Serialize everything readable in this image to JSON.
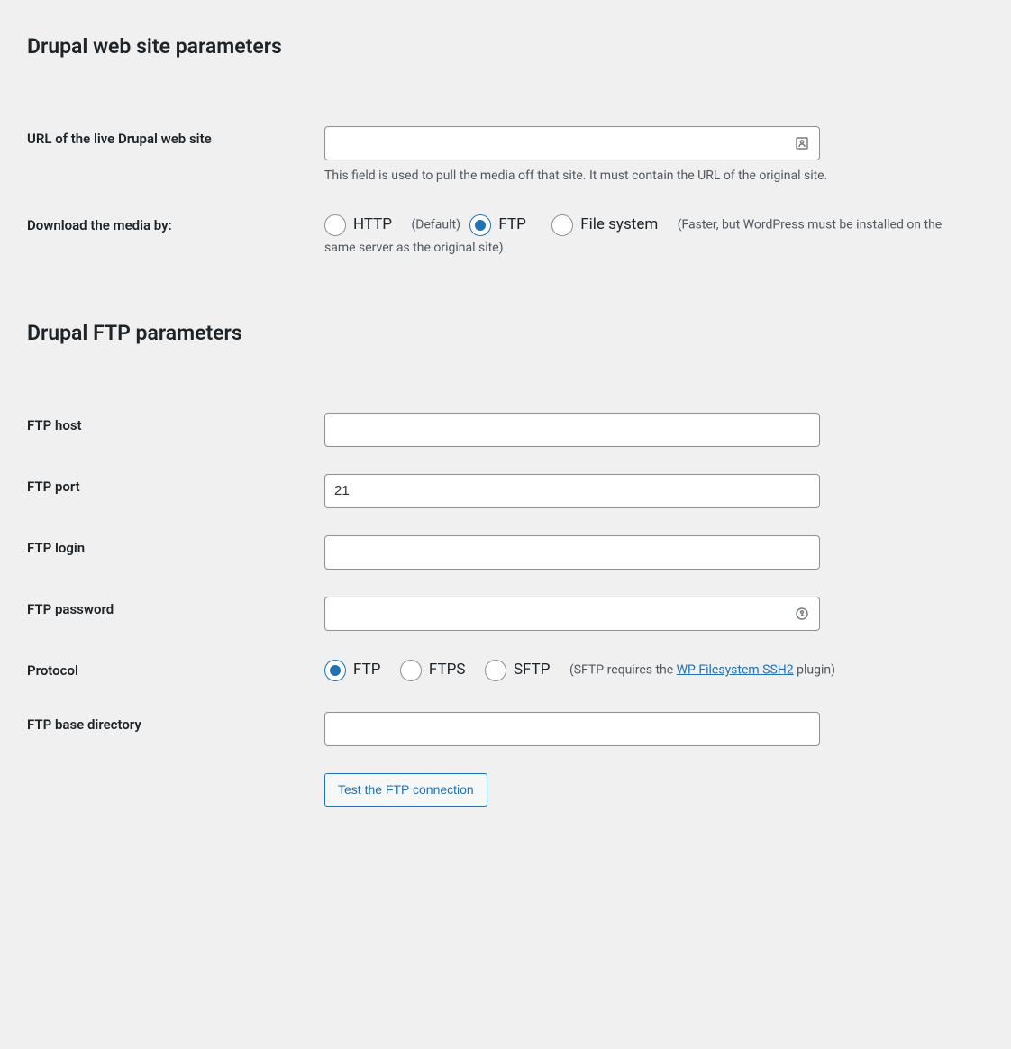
{
  "sections": {
    "website": {
      "heading": "Drupal web site parameters"
    },
    "ftp": {
      "heading": "Drupal FTP parameters"
    }
  },
  "fields": {
    "url": {
      "label": "URL of the live Drupal web site",
      "value": "",
      "description": "This field is used to pull the media off that site. It must contain the URL of the original site."
    },
    "download_media": {
      "label": "Download the media by:",
      "options": {
        "http": {
          "label": "HTTP",
          "suffix": "(Default)"
        },
        "ftp": {
          "label": "FTP"
        },
        "filesystem": {
          "label": "File system",
          "suffix": "(Faster, but WordPress must be installed on the same server as the original site)"
        }
      },
      "selected": "ftp"
    },
    "ftp_host": {
      "label": "FTP host",
      "value": ""
    },
    "ftp_port": {
      "label": "FTP port",
      "value": "21"
    },
    "ftp_login": {
      "label": "FTP login",
      "value": ""
    },
    "ftp_password": {
      "label": "FTP password",
      "value": ""
    },
    "protocol": {
      "label": "Protocol",
      "options": {
        "ftp": {
          "label": "FTP"
        },
        "ftps": {
          "label": "FTPS"
        },
        "sftp": {
          "label": "SFTP",
          "suffix_pre": "(SFTP requires the ",
          "link_text": "WP Filesystem SSH2",
          "suffix_post": " plugin)"
        }
      },
      "selected": "ftp"
    },
    "ftp_base_dir": {
      "label": "FTP base directory",
      "value": ""
    }
  },
  "buttons": {
    "test_ftp": {
      "label": "Test the FTP connection"
    }
  }
}
